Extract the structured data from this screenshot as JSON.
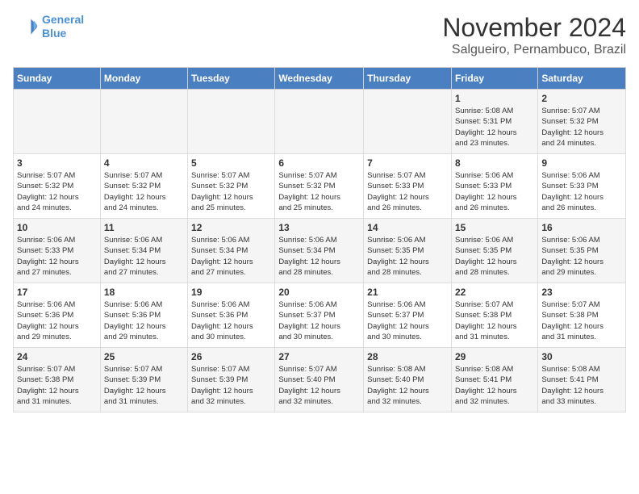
{
  "header": {
    "logo_line1": "General",
    "logo_line2": "Blue",
    "month": "November 2024",
    "location": "Salgueiro, Pernambuco, Brazil"
  },
  "weekdays": [
    "Sunday",
    "Monday",
    "Tuesday",
    "Wednesday",
    "Thursday",
    "Friday",
    "Saturday"
  ],
  "weeks": [
    [
      {
        "day": "",
        "info": ""
      },
      {
        "day": "",
        "info": ""
      },
      {
        "day": "",
        "info": ""
      },
      {
        "day": "",
        "info": ""
      },
      {
        "day": "",
        "info": ""
      },
      {
        "day": "1",
        "info": "Sunrise: 5:08 AM\nSunset: 5:31 PM\nDaylight: 12 hours\nand 23 minutes."
      },
      {
        "day": "2",
        "info": "Sunrise: 5:07 AM\nSunset: 5:32 PM\nDaylight: 12 hours\nand 24 minutes."
      }
    ],
    [
      {
        "day": "3",
        "info": "Sunrise: 5:07 AM\nSunset: 5:32 PM\nDaylight: 12 hours\nand 24 minutes."
      },
      {
        "day": "4",
        "info": "Sunrise: 5:07 AM\nSunset: 5:32 PM\nDaylight: 12 hours\nand 24 minutes."
      },
      {
        "day": "5",
        "info": "Sunrise: 5:07 AM\nSunset: 5:32 PM\nDaylight: 12 hours\nand 25 minutes."
      },
      {
        "day": "6",
        "info": "Sunrise: 5:07 AM\nSunset: 5:32 PM\nDaylight: 12 hours\nand 25 minutes."
      },
      {
        "day": "7",
        "info": "Sunrise: 5:07 AM\nSunset: 5:33 PM\nDaylight: 12 hours\nand 26 minutes."
      },
      {
        "day": "8",
        "info": "Sunrise: 5:06 AM\nSunset: 5:33 PM\nDaylight: 12 hours\nand 26 minutes."
      },
      {
        "day": "9",
        "info": "Sunrise: 5:06 AM\nSunset: 5:33 PM\nDaylight: 12 hours\nand 26 minutes."
      }
    ],
    [
      {
        "day": "10",
        "info": "Sunrise: 5:06 AM\nSunset: 5:33 PM\nDaylight: 12 hours\nand 27 minutes."
      },
      {
        "day": "11",
        "info": "Sunrise: 5:06 AM\nSunset: 5:34 PM\nDaylight: 12 hours\nand 27 minutes."
      },
      {
        "day": "12",
        "info": "Sunrise: 5:06 AM\nSunset: 5:34 PM\nDaylight: 12 hours\nand 27 minutes."
      },
      {
        "day": "13",
        "info": "Sunrise: 5:06 AM\nSunset: 5:34 PM\nDaylight: 12 hours\nand 28 minutes."
      },
      {
        "day": "14",
        "info": "Sunrise: 5:06 AM\nSunset: 5:35 PM\nDaylight: 12 hours\nand 28 minutes."
      },
      {
        "day": "15",
        "info": "Sunrise: 5:06 AM\nSunset: 5:35 PM\nDaylight: 12 hours\nand 28 minutes."
      },
      {
        "day": "16",
        "info": "Sunrise: 5:06 AM\nSunset: 5:35 PM\nDaylight: 12 hours\nand 29 minutes."
      }
    ],
    [
      {
        "day": "17",
        "info": "Sunrise: 5:06 AM\nSunset: 5:36 PM\nDaylight: 12 hours\nand 29 minutes."
      },
      {
        "day": "18",
        "info": "Sunrise: 5:06 AM\nSunset: 5:36 PM\nDaylight: 12 hours\nand 29 minutes."
      },
      {
        "day": "19",
        "info": "Sunrise: 5:06 AM\nSunset: 5:36 PM\nDaylight: 12 hours\nand 30 minutes."
      },
      {
        "day": "20",
        "info": "Sunrise: 5:06 AM\nSunset: 5:37 PM\nDaylight: 12 hours\nand 30 minutes."
      },
      {
        "day": "21",
        "info": "Sunrise: 5:06 AM\nSunset: 5:37 PM\nDaylight: 12 hours\nand 30 minutes."
      },
      {
        "day": "22",
        "info": "Sunrise: 5:07 AM\nSunset: 5:38 PM\nDaylight: 12 hours\nand 31 minutes."
      },
      {
        "day": "23",
        "info": "Sunrise: 5:07 AM\nSunset: 5:38 PM\nDaylight: 12 hours\nand 31 minutes."
      }
    ],
    [
      {
        "day": "24",
        "info": "Sunrise: 5:07 AM\nSunset: 5:38 PM\nDaylight: 12 hours\nand 31 minutes."
      },
      {
        "day": "25",
        "info": "Sunrise: 5:07 AM\nSunset: 5:39 PM\nDaylight: 12 hours\nand 31 minutes."
      },
      {
        "day": "26",
        "info": "Sunrise: 5:07 AM\nSunset: 5:39 PM\nDaylight: 12 hours\nand 32 minutes."
      },
      {
        "day": "27",
        "info": "Sunrise: 5:07 AM\nSunset: 5:40 PM\nDaylight: 12 hours\nand 32 minutes."
      },
      {
        "day": "28",
        "info": "Sunrise: 5:08 AM\nSunset: 5:40 PM\nDaylight: 12 hours\nand 32 minutes."
      },
      {
        "day": "29",
        "info": "Sunrise: 5:08 AM\nSunset: 5:41 PM\nDaylight: 12 hours\nand 32 minutes."
      },
      {
        "day": "30",
        "info": "Sunrise: 5:08 AM\nSunset: 5:41 PM\nDaylight: 12 hours\nand 33 minutes."
      }
    ]
  ]
}
